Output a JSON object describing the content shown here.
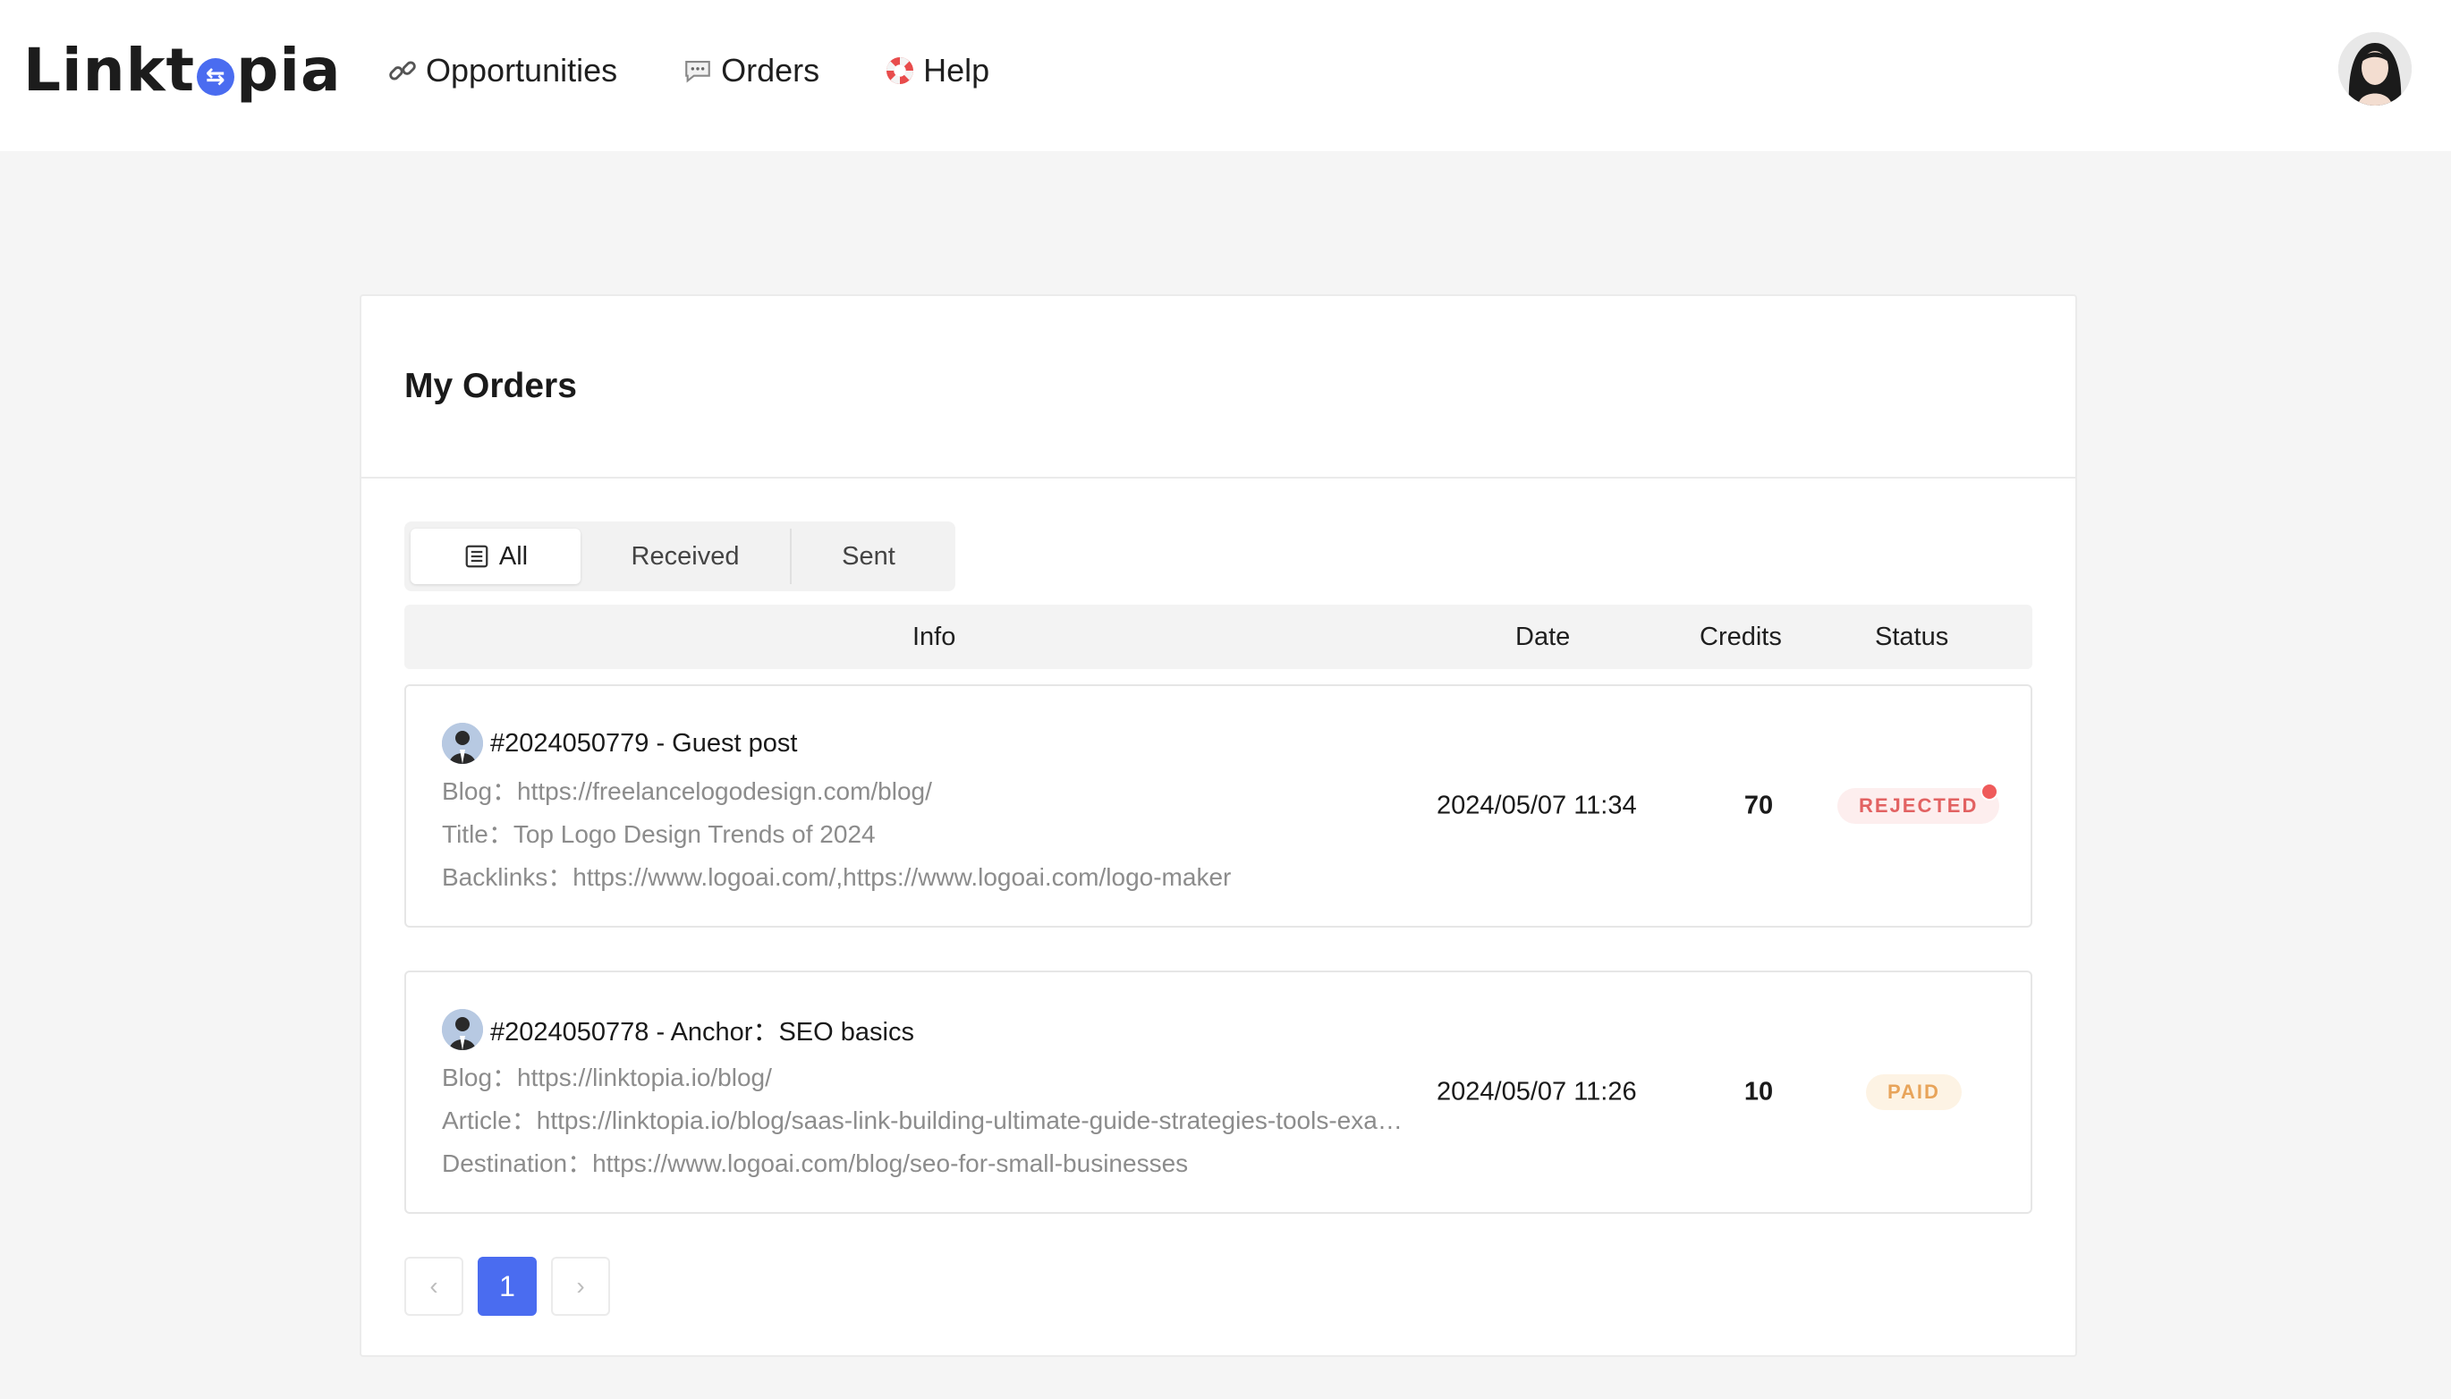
{
  "app": {
    "logo_text_left": "Linkt",
    "logo_text_right": "pia",
    "brand_color": "#4a6cf0"
  },
  "nav": {
    "items": [
      {
        "label": "Opportunities",
        "icon": "link-icon"
      },
      {
        "label": "Orders",
        "icon": "speech-bubble-icon"
      },
      {
        "label": "Help",
        "icon": "lifebuoy-icon"
      }
    ]
  },
  "user": {
    "avatar": "user-avatar"
  },
  "page": {
    "title": "My Orders"
  },
  "tabs": [
    {
      "label": "All",
      "icon": "list-icon",
      "active": true
    },
    {
      "label": "Received",
      "active": false
    },
    {
      "label": "Sent",
      "active": false
    }
  ],
  "table": {
    "headers": {
      "info": "Info",
      "date": "Date",
      "credits": "Credits",
      "status": "Status"
    }
  },
  "orders": [
    {
      "title": "#2024050779 - Guest post",
      "lines": [
        "Blog：https://freelancelogodesign.com/blog/",
        "Title：Top Logo Design Trends of 2024",
        "Backlinks：https://www.logoai.com/,https://www.logoai.com/logo-maker"
      ],
      "date": "2024/05/07 11:34",
      "credits": "70",
      "status": "REJECTED",
      "status_color": "#e26262",
      "unread": true
    },
    {
      "title": "#2024050778 - Anchor：SEO basics",
      "lines": [
        "Blog：https://linktopia.io/blog/",
        "Article：https://linktopia.io/blog/saas-link-building-ultimate-guide-strategies-tools-examples/",
        "Destination：https://www.logoai.com/blog/seo-for-small-businesses"
      ],
      "date": "2024/05/07 11:26",
      "credits": "10",
      "status": "PAID",
      "status_color": "#e8a45a",
      "unread": false
    }
  ],
  "pagination": {
    "prev": "‹",
    "current": "1",
    "next": "›"
  }
}
